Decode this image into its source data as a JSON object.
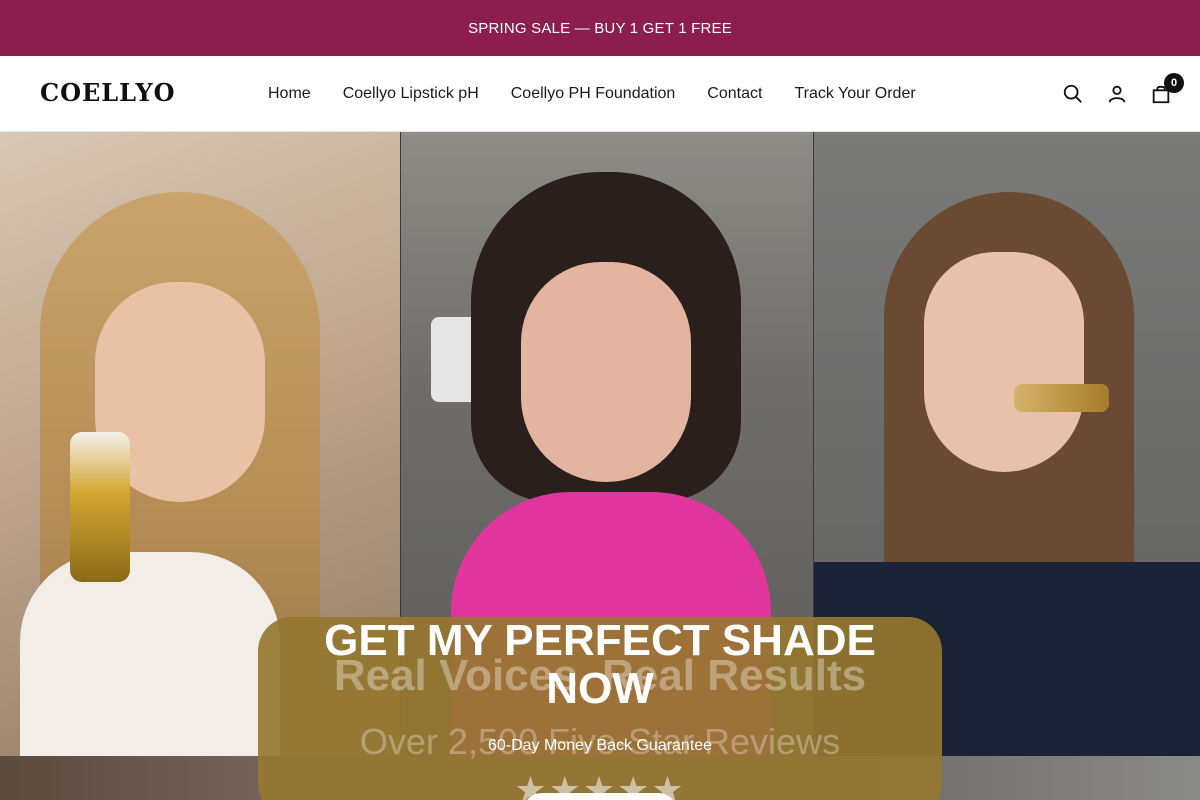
{
  "announcement": {
    "text": "SPRING SALE — BUY 1 GET 1 FREE"
  },
  "header": {
    "logo": "COELLYO",
    "nav": [
      {
        "label": "Home"
      },
      {
        "label": "Coellyo Lipstick pH"
      },
      {
        "label": "Coellyo PH Foundation"
      },
      {
        "label": "Contact"
      },
      {
        "label": "Track Your Order"
      }
    ],
    "icons": [
      "search-icon",
      "account-icon",
      "cart-icon"
    ],
    "cart_count": "0"
  },
  "hero": {
    "headline": "GET MY PERFECT SHADE NOW",
    "bg_text_1": "Real Voices, Real Results",
    "bg_text_2": "Over 2,500 Five-Star Reviews",
    "subline": "60-Day Money Back Guarantee",
    "stars": "★★★★★"
  },
  "colors": {
    "announcement_bg": "#8b1d4f",
    "overlay_bg": "#967730",
    "text_primary": "#111111"
  }
}
